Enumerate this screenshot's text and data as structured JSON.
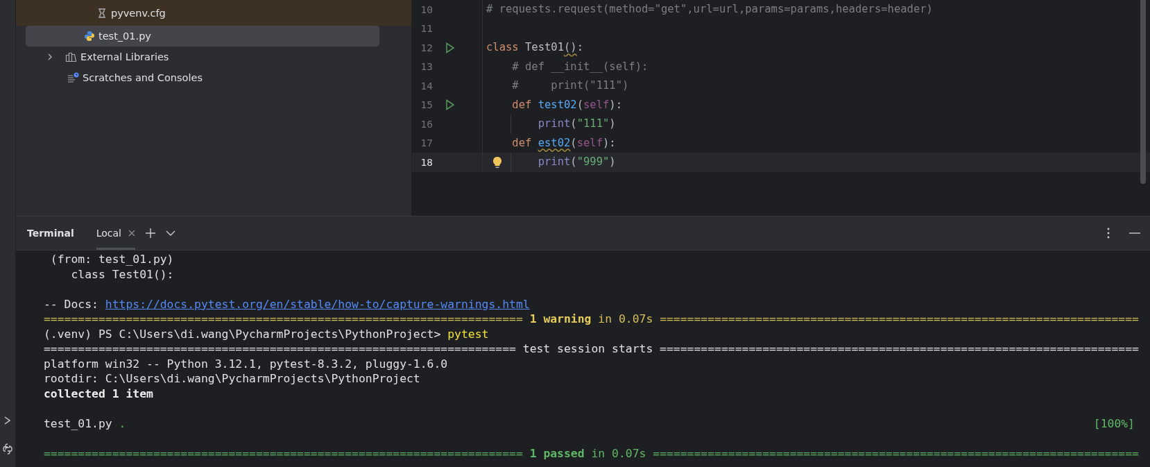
{
  "project_tree": {
    "items": [
      {
        "label": "pyvenv.cfg",
        "kind": "config",
        "selected": false,
        "excluded": true
      },
      {
        "label": "test_01.py",
        "kind": "python",
        "selected": true,
        "excluded": false
      },
      {
        "label": "External Libraries",
        "kind": "libraries",
        "selected": false,
        "excluded": false,
        "expanded": false
      },
      {
        "label": "Scratches and Consoles",
        "kind": "scratches",
        "selected": false,
        "excluded": false
      }
    ]
  },
  "editor": {
    "lines": [
      {
        "number": "10",
        "current": false,
        "tokens": [
          {
            "text": "# requests.request(method=\"get\",url=url,params=params,headers=header)",
            "kind": "comment"
          }
        ]
      },
      {
        "number": "11",
        "current": false
      },
      {
        "number": "12",
        "current": false,
        "run": true,
        "tokens": [
          {
            "text": "class",
            "kind": "keyword"
          },
          {
            "text": " Test01",
            "kind": "plain"
          },
          {
            "text": "()",
            "kind": "plain",
            "warning": true
          },
          {
            "text": ":",
            "kind": "plain"
          }
        ]
      },
      {
        "number": "13",
        "current": false,
        "tokens": [
          {
            "text": "    # def __init__(self):",
            "kind": "comment"
          }
        ]
      },
      {
        "number": "14",
        "current": false,
        "tokens": [
          {
            "text": "    #     print(\"111\")",
            "kind": "comment"
          }
        ]
      },
      {
        "number": "15",
        "current": false,
        "run": true,
        "tokens": [
          {
            "text": "    def",
            "kind": "keyword"
          },
          {
            "text": " test02",
            "kind": "function"
          },
          {
            "text": "(",
            "kind": "plain"
          },
          {
            "text": "self",
            "kind": "self"
          },
          {
            "text": "):",
            "kind": "plain"
          }
        ]
      },
      {
        "number": "16",
        "current": false,
        "guide": true,
        "tokens": [
          {
            "text": "        print",
            "kind": "builtin"
          },
          {
            "text": "(",
            "kind": "plain"
          },
          {
            "text": "\"111\"",
            "kind": "string"
          },
          {
            "text": ")",
            "kind": "plain"
          }
        ]
      },
      {
        "number": "17",
        "current": false,
        "tokens": [
          {
            "text": "    def ",
            "kind": "keyword"
          },
          {
            "text": "est02",
            "kind": "function",
            "warning": true
          },
          {
            "text": "(",
            "kind": "plain"
          },
          {
            "text": "self",
            "kind": "self"
          },
          {
            "text": "):",
            "kind": "plain"
          }
        ]
      },
      {
        "number": "18",
        "current": true,
        "bulb": true,
        "guide": true,
        "tokens": [
          {
            "text": "        print",
            "kind": "builtin"
          },
          {
            "text": "(",
            "kind": "plain"
          },
          {
            "text": "\"999\"",
            "kind": "string"
          },
          {
            "text": ")",
            "kind": "plain"
          }
        ]
      }
    ]
  },
  "terminal": {
    "title": "Terminal",
    "tabs": [
      {
        "label": "Local",
        "selected": true
      }
    ],
    "lines": [
      {
        "tokens": [
          {
            "text": " (from: test_01.py)",
            "kind": "plain"
          }
        ]
      },
      {
        "tokens": [
          {
            "text": "    class Test01():",
            "kind": "plain"
          }
        ]
      },
      {
        "blank_before": true,
        "tokens": [
          {
            "text": "-- Docs: ",
            "kind": "plain"
          },
          {
            "text": "https://docs.pytest.org/en/stable/how-to/capture-warnings.html",
            "kind": "link"
          }
        ]
      },
      {
        "tokens": [
          {
            "text": "====================================================================== ",
            "kind": "yellow"
          },
          {
            "text": "1 warning",
            "kind": "yellow_bold"
          },
          {
            "text": " in 0.07s ======================================================================",
            "kind": "yellow"
          }
        ]
      },
      {
        "tokens": [
          {
            "text": "(.venv) PS C:\\Users\\di.wang\\PycharmProjects\\PythonProject> ",
            "kind": "plain"
          },
          {
            "text": "pytest",
            "kind": "bright_yellow"
          }
        ]
      },
      {
        "tokens": [
          {
            "text": "===================================================================== test session starts ======================================================================",
            "kind": "plain"
          }
        ]
      },
      {
        "tokens": [
          {
            "text": "platform win32 -- Python 3.12.1, pytest-8.3.2, pluggy-1.6.0",
            "kind": "plain"
          }
        ]
      },
      {
        "tokens": [
          {
            "text": "rootdir: C:\\Users\\di.wang\\PycharmProjects\\PythonProject",
            "kind": "plain"
          }
        ]
      },
      {
        "tokens": [
          {
            "text": "collected 1 item",
            "kind": "bold"
          }
        ]
      },
      {
        "blank_before": true,
        "tokens": [
          {
            "text": "test_01.py ",
            "kind": "plain"
          },
          {
            "text": ".",
            "kind": "green"
          }
        ],
        "right": "[100%]"
      },
      {
        "blank_before": true,
        "tokens": [
          {
            "text": "====================================================================== ",
            "kind": "green"
          },
          {
            "text": "1 passed",
            "kind": "green_bold"
          },
          {
            "text": " in 0.07s =======================================================================",
            "kind": "green"
          }
        ]
      }
    ]
  }
}
